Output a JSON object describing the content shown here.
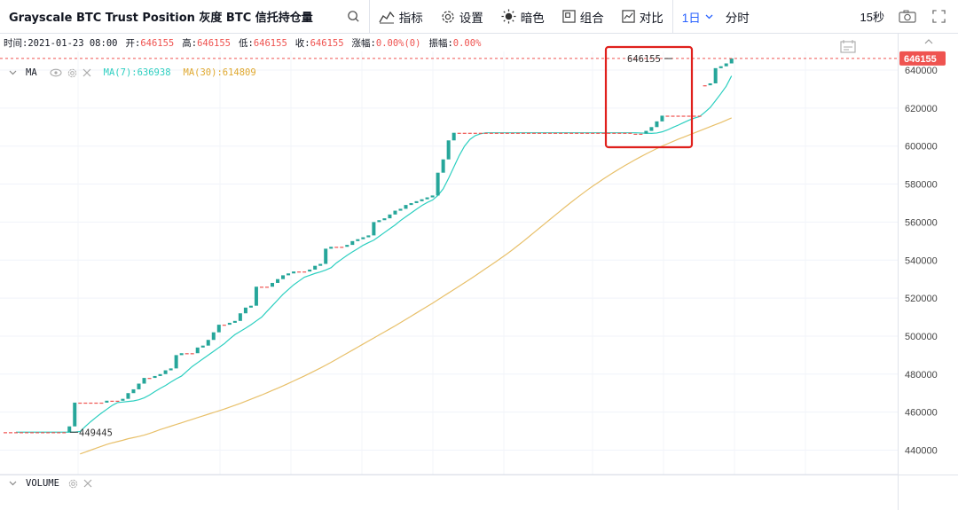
{
  "toolbar": {
    "title": "Grayscale BTC Trust Position 灰度 BTC 信托持仓量",
    "indicators_label": "指标",
    "settings_label": "设置",
    "dark_label": "暗色",
    "combo_label": "组合",
    "compare_label": "对比",
    "interval_label": "1日",
    "timeshare_label": "分时",
    "countdown_label": "15秒"
  },
  "infobar": {
    "time_label": "时间:",
    "time_value": "2021-01-23 08:00",
    "open_label": "开:",
    "open_value": "646155",
    "high_label": "高:",
    "high_value": "646155",
    "low_label": "低:",
    "low_value": "646155",
    "close_label": "收:",
    "close_value": "646155",
    "change_label": "涨幅:",
    "change_value": "0.00%(0)",
    "amplitude_label": "振幅:",
    "amplitude_value": "0.00%"
  },
  "legend": {
    "ma_label": "MA",
    "ma7_label": "MA(7):636938",
    "ma30_label": "MA(30):614809"
  },
  "volume_label": "VOLUME",
  "colors": {
    "up": "#26a69a",
    "down": "#ef5350",
    "ma7": "#2ccfc0",
    "ma30": "#e8c06a",
    "highlight": "#e0201c",
    "brand": "#2962ff"
  },
  "chart_data": {
    "type": "candlestick",
    "ylim": [
      430000,
      650000
    ],
    "yticks": [
      "440000",
      "460000",
      "480000",
      "500000",
      "520000",
      "540000",
      "560000",
      "580000",
      "600000",
      "620000",
      "640000"
    ],
    "last_price_label": "646155",
    "high_marker_label": "646155",
    "low_marker_label": "449445",
    "candles": [
      {
        "o": 449445,
        "c": 449445
      },
      {
        "o": 449445,
        "c": 449445
      },
      {
        "o": 449445,
        "c": 449445
      },
      {
        "o": 449445,
        "c": 449445
      },
      {
        "o": 449445,
        "c": 449445
      },
      {
        "o": 449445,
        "c": 449445
      },
      {
        "o": 449445,
        "c": 449445
      },
      {
        "o": 449445,
        "c": 449445
      },
      {
        "o": 449445,
        "c": 449445
      },
      {
        "o": 449445,
        "c": 449445
      },
      {
        "o": 449445,
        "c": 449445
      },
      {
        "o": 449445,
        "c": 449445
      },
      {
        "o": 449445,
        "c": 452500
      },
      {
        "o": 452500,
        "c": 465000
      },
      {
        "o": 465000,
        "c": 465000
      },
      {
        "o": 465000,
        "c": 465000
      },
      {
        "o": 465000,
        "c": 465000
      },
      {
        "o": 465000,
        "c": 465000
      },
      {
        "o": 465000,
        "c": 465000
      },
      {
        "o": 465000,
        "c": 466000
      },
      {
        "o": 466000,
        "c": 466000
      },
      {
        "o": 466000,
        "c": 466000
      },
      {
        "o": 466000,
        "c": 467000
      },
      {
        "o": 467000,
        "c": 470000
      },
      {
        "o": 470000,
        "c": 472000
      },
      {
        "o": 472000,
        "c": 475000
      },
      {
        "o": 475000,
        "c": 478000
      },
      {
        "o": 478000,
        "c": 478000
      },
      {
        "o": 478000,
        "c": 479000
      },
      {
        "o": 479000,
        "c": 480000
      },
      {
        "o": 480000,
        "c": 482000
      },
      {
        "o": 482000,
        "c": 483000
      },
      {
        "o": 483000,
        "c": 490000
      },
      {
        "o": 490000,
        "c": 491000
      },
      {
        "o": 491000,
        "c": 491000
      },
      {
        "o": 491000,
        "c": 491000
      },
      {
        "o": 491000,
        "c": 494000
      },
      {
        "o": 494000,
        "c": 495000
      },
      {
        "o": 495000,
        "c": 498000
      },
      {
        "o": 498000,
        "c": 502000
      },
      {
        "o": 502000,
        "c": 506000
      },
      {
        "o": 506000,
        "c": 506000
      },
      {
        "o": 506000,
        "c": 507000
      },
      {
        "o": 507000,
        "c": 508000
      },
      {
        "o": 508000,
        "c": 512000
      },
      {
        "o": 512000,
        "c": 515000
      },
      {
        "o": 515000,
        "c": 516000
      },
      {
        "o": 516000,
        "c": 526000
      },
      {
        "o": 526000,
        "c": 526000
      },
      {
        "o": 526000,
        "c": 526000
      },
      {
        "o": 526000,
        "c": 528000
      },
      {
        "o": 528000,
        "c": 530000
      },
      {
        "o": 530000,
        "c": 532000
      },
      {
        "o": 532000,
        "c": 533000
      },
      {
        "o": 533000,
        "c": 534000
      },
      {
        "o": 534000,
        "c": 534000
      },
      {
        "o": 534000,
        "c": 534000
      },
      {
        "o": 534000,
        "c": 535000
      },
      {
        "o": 535000,
        "c": 537000
      },
      {
        "o": 537000,
        "c": 538000
      },
      {
        "o": 538000,
        "c": 546000
      },
      {
        "o": 546000,
        "c": 547000
      },
      {
        "o": 547000,
        "c": 547000
      },
      {
        "o": 547000,
        "c": 547000
      },
      {
        "o": 547000,
        "c": 548000
      },
      {
        "o": 548000,
        "c": 550000
      },
      {
        "o": 550000,
        "c": 551000
      },
      {
        "o": 551000,
        "c": 552000
      },
      {
        "o": 552000,
        "c": 553000
      },
      {
        "o": 553000,
        "c": 560000
      },
      {
        "o": 560000,
        "c": 561000
      },
      {
        "o": 561000,
        "c": 562000
      },
      {
        "o": 562000,
        "c": 564000
      },
      {
        "o": 564000,
        "c": 566000
      },
      {
        "o": 566000,
        "c": 567000
      },
      {
        "o": 567000,
        "c": 569000
      },
      {
        "o": 569000,
        "c": 570000
      },
      {
        "o": 570000,
        "c": 571000
      },
      {
        "o": 571000,
        "c": 572000
      },
      {
        "o": 572000,
        "c": 573000
      },
      {
        "o": 573000,
        "c": 574000
      },
      {
        "o": 574000,
        "c": 586000
      },
      {
        "o": 586000,
        "c": 593000
      },
      {
        "o": 593000,
        "c": 603000
      },
      {
        "o": 603000,
        "c": 607000
      },
      {
        "o": 607000,
        "c": 607000
      },
      {
        "o": 607000,
        "c": 607000
      },
      {
        "o": 607000,
        "c": 607000
      },
      {
        "o": 607000,
        "c": 607000
      },
      {
        "o": 607000,
        "c": 607000
      },
      {
        "o": 607000,
        "c": 607000
      },
      {
        "o": 607000,
        "c": 607000
      },
      {
        "o": 607000,
        "c": 607000
      },
      {
        "o": 607000,
        "c": 607000
      },
      {
        "o": 607000,
        "c": 607000
      },
      {
        "o": 607000,
        "c": 607000
      },
      {
        "o": 607000,
        "c": 607000
      },
      {
        "o": 607000,
        "c": 607000
      },
      {
        "o": 607000,
        "c": 607000
      },
      {
        "o": 607000,
        "c": 607000
      },
      {
        "o": 607000,
        "c": 607000
      },
      {
        "o": 607000,
        "c": 607000
      },
      {
        "o": 607000,
        "c": 607000
      },
      {
        "o": 607000,
        "c": 607000
      },
      {
        "o": 607000,
        "c": 607000
      },
      {
        "o": 607000,
        "c": 607000
      },
      {
        "o": 607000,
        "c": 607000
      },
      {
        "o": 607000,
        "c": 607000
      },
      {
        "o": 607000,
        "c": 607000
      },
      {
        "o": 607000,
        "c": 607000
      },
      {
        "o": 607000,
        "c": 607000
      },
      {
        "o": 607000,
        "c": 607000
      },
      {
        "o": 607000,
        "c": 607000
      },
      {
        "o": 607000,
        "c": 607000
      },
      {
        "o": 607000,
        "c": 607000
      },
      {
        "o": 607000,
        "c": 607000
      },
      {
        "o": 607000,
        "c": 607000
      },
      {
        "o": 607000,
        "c": 606500
      },
      {
        "o": 606500,
        "c": 606500
      },
      {
        "o": 606500,
        "c": 606500
      },
      {
        "o": 606500,
        "c": 608000
      },
      {
        "o": 608000,
        "c": 610000
      },
      {
        "o": 610000,
        "c": 613000
      },
      {
        "o": 613000,
        "c": 616000
      },
      {
        "o": 616000,
        "c": 616000
      },
      {
        "o": 616000,
        "c": 616000
      },
      {
        "o": 616000,
        "c": 616000
      },
      {
        "o": 616000,
        "c": 616000
      },
      {
        "o": 616000,
        "c": 616000
      },
      {
        "o": 616000,
        "c": 616000
      },
      {
        "o": 616000,
        "c": 616000
      },
      {
        "o": 632000,
        "c": 632000
      },
      {
        "o": 632000,
        "c": 633000
      },
      {
        "o": 633000,
        "c": 641000
      },
      {
        "o": 641000,
        "c": 642000
      },
      {
        "o": 642000,
        "c": 643500
      },
      {
        "o": 643500,
        "c": 646155
      }
    ],
    "ma7": [
      449445,
      449445,
      449445,
      449445,
      449445,
      449445,
      449445,
      449445,
      449445,
      449445,
      449445,
      449445,
      449800,
      452500,
      455000,
      457300,
      459500,
      461500,
      463500,
      465000,
      465300,
      465600,
      465900,
      466500,
      467500,
      469000,
      470800,
      472500,
      474000,
      475800,
      477500,
      479000,
      481500,
      484000,
      486000,
      488000,
      490000,
      492000,
      494000,
      496000,
      498500,
      500800,
      502500,
      504200,
      506000,
      508000,
      510000,
      513000,
      516000,
      519000,
      522000,
      524500,
      527000,
      529000,
      531000,
      532000,
      533000,
      533800,
      534800,
      536000,
      538500,
      540500,
      542500,
      544300,
      546000,
      547800,
      549200,
      550500,
      552500,
      554500,
      556500,
      558500,
      560800,
      562800,
      564800,
      566800,
      568700,
      570300,
      571600,
      574000,
      577500,
      583000,
      589000,
      595000,
      600000,
      603500,
      605500,
      606500,
      607000,
      607000,
      607000,
      607000,
      607000,
      607000,
      607000,
      607000,
      607000,
      607000,
      607000,
      607000,
      607000,
      607000,
      607000,
      607000,
      607000,
      607000,
      607000,
      607000,
      607000,
      607000,
      607000,
      607000,
      607000,
      607000,
      607000,
      607000,
      607000,
      606900,
      606800,
      606700,
      606900,
      607500,
      608500,
      609800,
      611000,
      612300,
      613600,
      614700,
      615500,
      617800,
      620300,
      623900,
      627600,
      631500,
      636938
    ],
    "ma30": [
      438000,
      439000,
      440000,
      441000,
      442000,
      443000,
      443800,
      444500,
      445200,
      446000,
      446600,
      447200,
      447900,
      448800,
      449800,
      450800,
      451700,
      452600,
      453500,
      454400,
      455300,
      456200,
      457100,
      458000,
      458900,
      459800,
      460700,
      461600,
      462600,
      463600,
      464600,
      465700,
      466800,
      467900,
      469000,
      470200,
      471400,
      472600,
      473800,
      475100,
      476400,
      477700,
      479000,
      480400,
      481800,
      483200,
      484700,
      486200,
      487800,
      489400,
      491000,
      492600,
      494200,
      495800,
      497400,
      499000,
      500600,
      502200,
      503800,
      505400,
      507100,
      508800,
      510500,
      512200,
      513900,
      515600,
      517300,
      519100,
      520900,
      522700,
      524500,
      526300,
      528100,
      529900,
      531800,
      533700,
      535600,
      537500,
      539400,
      541400,
      543400,
      545500,
      547700,
      549900,
      552200,
      554500,
      556800,
      559100,
      561400,
      563700,
      566000,
      568300,
      570500,
      572700,
      574800,
      576900,
      578900,
      580800,
      582700,
      584500,
      586300,
      588000,
      589700,
      591300,
      592900,
      594400,
      595900,
      597300,
      598700,
      600000,
      601200,
      602400,
      603600,
      604700,
      605800,
      606900,
      608000,
      609100,
      610200,
      611300,
      612400,
      613600,
      614809
    ]
  }
}
